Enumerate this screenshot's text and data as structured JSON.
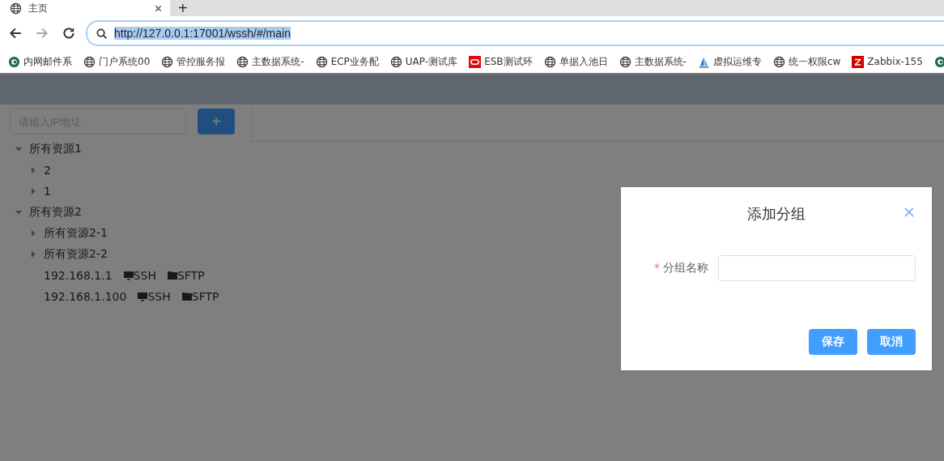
{
  "browser": {
    "tabs": [
      {
        "title": "主页",
        "selected": true
      }
    ],
    "new_tab": "+",
    "url": "http://127.0.0.1:17001/wssh/#/main",
    "url_selected": true,
    "forward_disabled": true,
    "bookmarks": [
      {
        "label": "内网邮件系",
        "kind": "mail"
      },
      {
        "label": "门户系统00",
        "kind": "globe"
      },
      {
        "label": "管控服务报",
        "kind": "globe"
      },
      {
        "label": "主数据系统-",
        "kind": "globe"
      },
      {
        "label": "ECP业务配",
        "kind": "globe"
      },
      {
        "label": "UAP-测试库",
        "kind": "globe"
      },
      {
        "label": "ESB测试环",
        "kind": "oracle"
      },
      {
        "label": "单据入池日",
        "kind": "globe"
      },
      {
        "label": "主数据系统-",
        "kind": "globe"
      },
      {
        "label": "虚拟运维专",
        "kind": "sail"
      },
      {
        "label": "统一权限cw",
        "kind": "globe"
      },
      {
        "label": "Zabbix-155",
        "kind": "zabbix"
      },
      {
        "kind": "mail"
      }
    ]
  },
  "sidebar": {
    "search": {
      "placeholder": "请输入IP地址"
    },
    "add_button": "+",
    "tree": [
      {
        "kind": "group",
        "label": "所有资源1",
        "expanded": true,
        "children": [
          {
            "kind": "group",
            "label": "2",
            "expanded": false
          },
          {
            "kind": "group",
            "label": "1",
            "expanded": false
          }
        ]
      },
      {
        "kind": "group",
        "label": "所有资源2",
        "expanded": true,
        "children": [
          {
            "kind": "group",
            "label": "所有资源2-1",
            "expanded": false
          },
          {
            "kind": "group",
            "label": "所有资源2-2",
            "expanded": false
          },
          {
            "kind": "host",
            "label": "192.168.1.1",
            "actions": [
              {
                "kind": "terminal",
                "label": "SSH"
              },
              {
                "kind": "folder",
                "label": "SFTP"
              }
            ]
          },
          {
            "kind": "host",
            "label": "192.168.1.100",
            "actions": [
              {
                "kind": "terminal",
                "label": "SSH"
              },
              {
                "kind": "folder",
                "label": "SFTP"
              }
            ]
          }
        ]
      }
    ]
  },
  "dialog": {
    "title": "添加分组",
    "field": {
      "label": "分组名称",
      "required_mark": "*"
    },
    "buttons": [
      {
        "label": "保存"
      },
      {
        "label": "取消"
      }
    ]
  }
}
